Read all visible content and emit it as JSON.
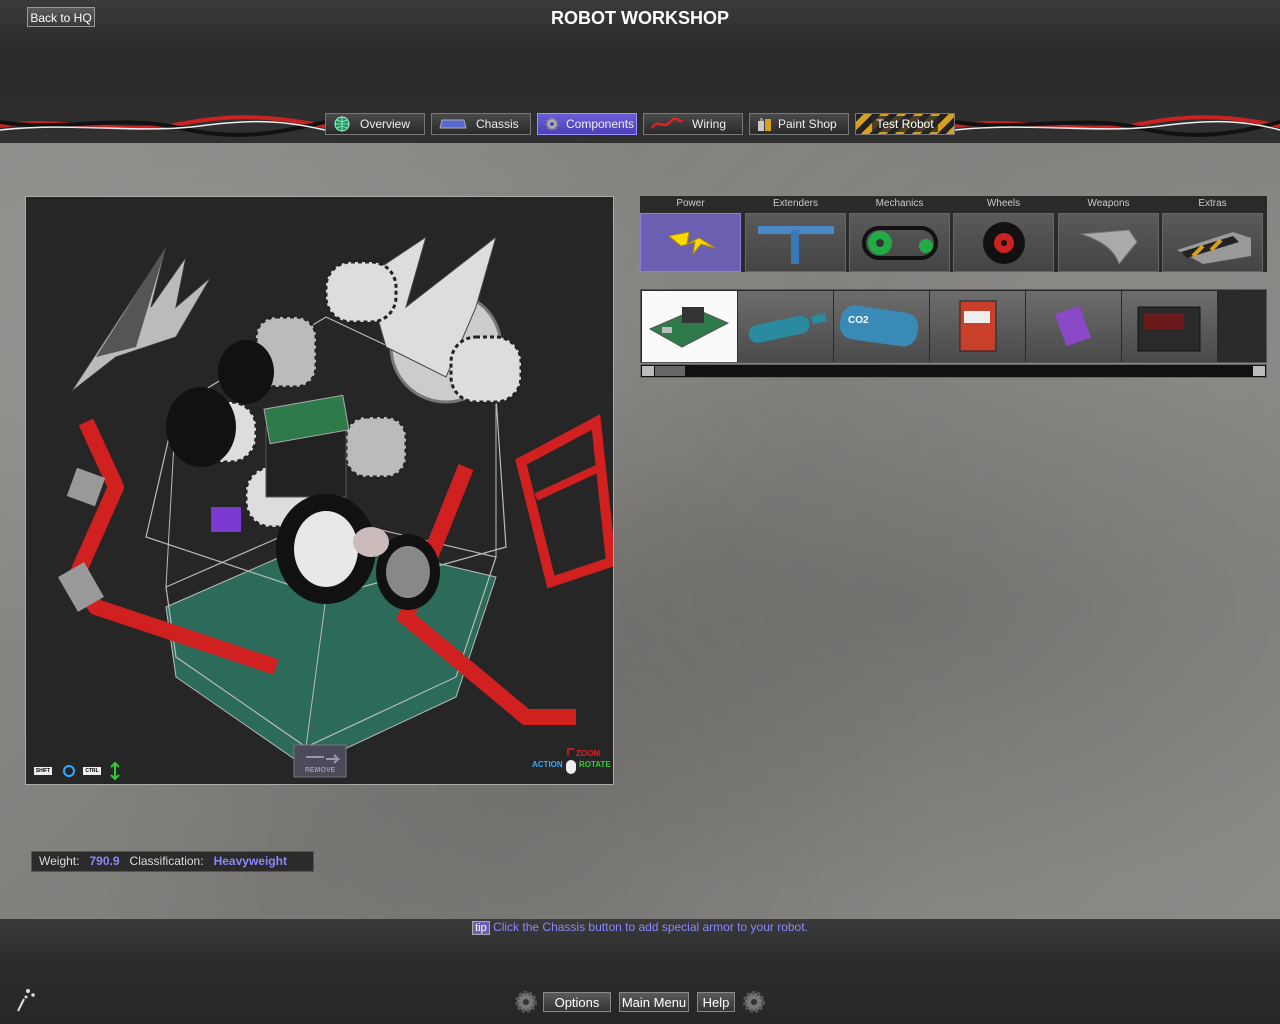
{
  "header": {
    "back_label": "Back to HQ",
    "title": "ROBOT WORKSHOP"
  },
  "tabs": [
    {
      "label": "Overview",
      "icon": "globe-icon"
    },
    {
      "label": "Chassis",
      "icon": "chassis-plate-icon"
    },
    {
      "label": "Components",
      "icon": "gear-icon",
      "active": true
    },
    {
      "label": "Wiring",
      "icon": "wire-icon"
    },
    {
      "label": "Paint Shop",
      "icon": "paint-can-icon"
    },
    {
      "label": "Test Robot",
      "icon": "hazard-stripes"
    }
  ],
  "categories": [
    {
      "label": "Power",
      "icon": "lightning-icon",
      "active": true
    },
    {
      "label": "Extenders",
      "icon": "t-bar-icon"
    },
    {
      "label": "Mechanics",
      "icon": "chain-drive-icon"
    },
    {
      "label": "Wheels",
      "icon": "wheel-icon"
    },
    {
      "label": "Weapons",
      "icon": "blade-icon"
    },
    {
      "label": "Extras",
      "icon": "wedge-icon"
    }
  ],
  "parts": [
    {
      "icon": "circuit-board-icon",
      "selected": true
    },
    {
      "icon": "co2-cylinder-icon"
    },
    {
      "icon": "co2-tank-icon",
      "text": "CO2"
    },
    {
      "icon": "battery-red-icon"
    },
    {
      "icon": "battery-pack-icon"
    },
    {
      "icon": "battery-black-icon"
    }
  ],
  "viewport": {
    "shift_key": "SHIFT",
    "ctrl_key": "CTRL",
    "remove_label": "REMOVE",
    "zoom_label": "ZOOM",
    "action_label": "ACTION",
    "rotate_label": "ROTATE"
  },
  "status": {
    "weight_label": "Weight:",
    "weight_value": "790.9",
    "class_label": "Classification:",
    "class_value": "Heavyweight"
  },
  "tip": {
    "badge": "tip",
    "text": "Click the Chassis button to add special armor to your robot."
  },
  "menu": {
    "options": "Options",
    "main_menu": "Main Menu",
    "help": "Help"
  },
  "colors": {
    "accent": "#6a5fd8",
    "value_text": "#8a88ff",
    "hazard": "#d8a020"
  }
}
